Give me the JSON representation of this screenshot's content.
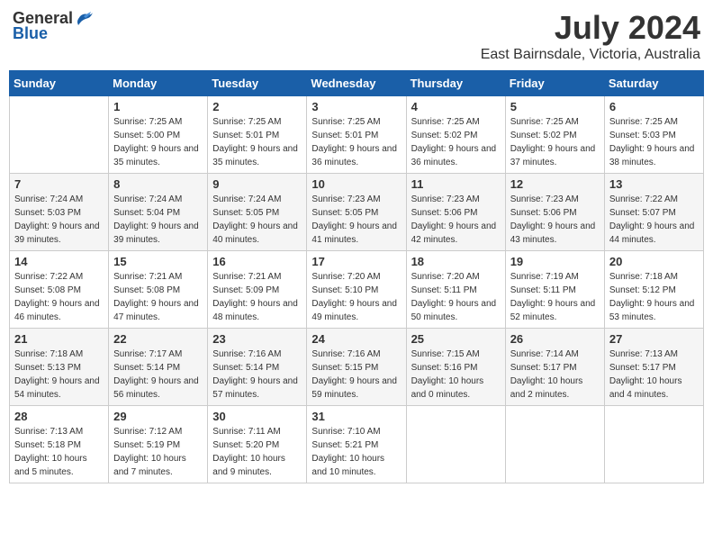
{
  "header": {
    "logo_general": "General",
    "logo_blue": "Blue",
    "month_title": "July 2024",
    "location": "East Bairnsdale, Victoria, Australia"
  },
  "weekdays": [
    "Sunday",
    "Monday",
    "Tuesday",
    "Wednesday",
    "Thursday",
    "Friday",
    "Saturday"
  ],
  "weeks": [
    [
      {
        "day": "",
        "sunrise": "",
        "sunset": "",
        "daylight": ""
      },
      {
        "day": "1",
        "sunrise": "Sunrise: 7:25 AM",
        "sunset": "Sunset: 5:00 PM",
        "daylight": "Daylight: 9 hours and 35 minutes."
      },
      {
        "day": "2",
        "sunrise": "Sunrise: 7:25 AM",
        "sunset": "Sunset: 5:01 PM",
        "daylight": "Daylight: 9 hours and 35 minutes."
      },
      {
        "day": "3",
        "sunrise": "Sunrise: 7:25 AM",
        "sunset": "Sunset: 5:01 PM",
        "daylight": "Daylight: 9 hours and 36 minutes."
      },
      {
        "day": "4",
        "sunrise": "Sunrise: 7:25 AM",
        "sunset": "Sunset: 5:02 PM",
        "daylight": "Daylight: 9 hours and 36 minutes."
      },
      {
        "day": "5",
        "sunrise": "Sunrise: 7:25 AM",
        "sunset": "Sunset: 5:02 PM",
        "daylight": "Daylight: 9 hours and 37 minutes."
      },
      {
        "day": "6",
        "sunrise": "Sunrise: 7:25 AM",
        "sunset": "Sunset: 5:03 PM",
        "daylight": "Daylight: 9 hours and 38 minutes."
      }
    ],
    [
      {
        "day": "7",
        "sunrise": "Sunrise: 7:24 AM",
        "sunset": "Sunset: 5:03 PM",
        "daylight": "Daylight: 9 hours and 39 minutes."
      },
      {
        "day": "8",
        "sunrise": "Sunrise: 7:24 AM",
        "sunset": "Sunset: 5:04 PM",
        "daylight": "Daylight: 9 hours and 39 minutes."
      },
      {
        "day": "9",
        "sunrise": "Sunrise: 7:24 AM",
        "sunset": "Sunset: 5:05 PM",
        "daylight": "Daylight: 9 hours and 40 minutes."
      },
      {
        "day": "10",
        "sunrise": "Sunrise: 7:23 AM",
        "sunset": "Sunset: 5:05 PM",
        "daylight": "Daylight: 9 hours and 41 minutes."
      },
      {
        "day": "11",
        "sunrise": "Sunrise: 7:23 AM",
        "sunset": "Sunset: 5:06 PM",
        "daylight": "Daylight: 9 hours and 42 minutes."
      },
      {
        "day": "12",
        "sunrise": "Sunrise: 7:23 AM",
        "sunset": "Sunset: 5:06 PM",
        "daylight": "Daylight: 9 hours and 43 minutes."
      },
      {
        "day": "13",
        "sunrise": "Sunrise: 7:22 AM",
        "sunset": "Sunset: 5:07 PM",
        "daylight": "Daylight: 9 hours and 44 minutes."
      }
    ],
    [
      {
        "day": "14",
        "sunrise": "Sunrise: 7:22 AM",
        "sunset": "Sunset: 5:08 PM",
        "daylight": "Daylight: 9 hours and 46 minutes."
      },
      {
        "day": "15",
        "sunrise": "Sunrise: 7:21 AM",
        "sunset": "Sunset: 5:08 PM",
        "daylight": "Daylight: 9 hours and 47 minutes."
      },
      {
        "day": "16",
        "sunrise": "Sunrise: 7:21 AM",
        "sunset": "Sunset: 5:09 PM",
        "daylight": "Daylight: 9 hours and 48 minutes."
      },
      {
        "day": "17",
        "sunrise": "Sunrise: 7:20 AM",
        "sunset": "Sunset: 5:10 PM",
        "daylight": "Daylight: 9 hours and 49 minutes."
      },
      {
        "day": "18",
        "sunrise": "Sunrise: 7:20 AM",
        "sunset": "Sunset: 5:11 PM",
        "daylight": "Daylight: 9 hours and 50 minutes."
      },
      {
        "day": "19",
        "sunrise": "Sunrise: 7:19 AM",
        "sunset": "Sunset: 5:11 PM",
        "daylight": "Daylight: 9 hours and 52 minutes."
      },
      {
        "day": "20",
        "sunrise": "Sunrise: 7:18 AM",
        "sunset": "Sunset: 5:12 PM",
        "daylight": "Daylight: 9 hours and 53 minutes."
      }
    ],
    [
      {
        "day": "21",
        "sunrise": "Sunrise: 7:18 AM",
        "sunset": "Sunset: 5:13 PM",
        "daylight": "Daylight: 9 hours and 54 minutes."
      },
      {
        "day": "22",
        "sunrise": "Sunrise: 7:17 AM",
        "sunset": "Sunset: 5:14 PM",
        "daylight": "Daylight: 9 hours and 56 minutes."
      },
      {
        "day": "23",
        "sunrise": "Sunrise: 7:16 AM",
        "sunset": "Sunset: 5:14 PM",
        "daylight": "Daylight: 9 hours and 57 minutes."
      },
      {
        "day": "24",
        "sunrise": "Sunrise: 7:16 AM",
        "sunset": "Sunset: 5:15 PM",
        "daylight": "Daylight: 9 hours and 59 minutes."
      },
      {
        "day": "25",
        "sunrise": "Sunrise: 7:15 AM",
        "sunset": "Sunset: 5:16 PM",
        "daylight": "Daylight: 10 hours and 0 minutes."
      },
      {
        "day": "26",
        "sunrise": "Sunrise: 7:14 AM",
        "sunset": "Sunset: 5:17 PM",
        "daylight": "Daylight: 10 hours and 2 minutes."
      },
      {
        "day": "27",
        "sunrise": "Sunrise: 7:13 AM",
        "sunset": "Sunset: 5:17 PM",
        "daylight": "Daylight: 10 hours and 4 minutes."
      }
    ],
    [
      {
        "day": "28",
        "sunrise": "Sunrise: 7:13 AM",
        "sunset": "Sunset: 5:18 PM",
        "daylight": "Daylight: 10 hours and 5 minutes."
      },
      {
        "day": "29",
        "sunrise": "Sunrise: 7:12 AM",
        "sunset": "Sunset: 5:19 PM",
        "daylight": "Daylight: 10 hours and 7 minutes."
      },
      {
        "day": "30",
        "sunrise": "Sunrise: 7:11 AM",
        "sunset": "Sunset: 5:20 PM",
        "daylight": "Daylight: 10 hours and 9 minutes."
      },
      {
        "day": "31",
        "sunrise": "Sunrise: 7:10 AM",
        "sunset": "Sunset: 5:21 PM",
        "daylight": "Daylight: 10 hours and 10 minutes."
      },
      {
        "day": "",
        "sunrise": "",
        "sunset": "",
        "daylight": ""
      },
      {
        "day": "",
        "sunrise": "",
        "sunset": "",
        "daylight": ""
      },
      {
        "day": "",
        "sunrise": "",
        "sunset": "",
        "daylight": ""
      }
    ]
  ]
}
